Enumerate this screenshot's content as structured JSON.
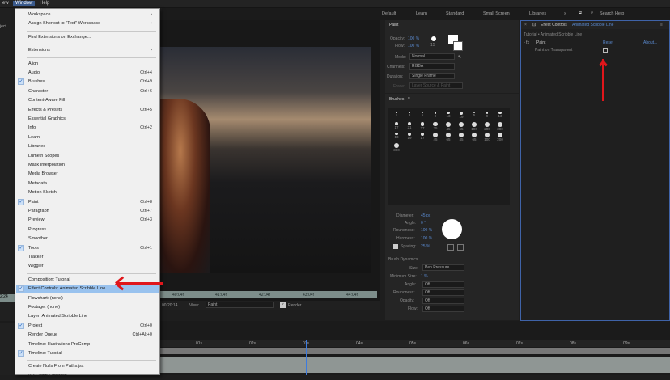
{
  "menubar": {
    "items": [
      "ew",
      "Window",
      "Help"
    ]
  },
  "workspaces": [
    "Default",
    "Learn",
    "Standard",
    "Small Screen",
    "Libraries"
  ],
  "search_placeholder": "Search Help",
  "menu": {
    "items": [
      {
        "label": "Workspace",
        "shortcut": "",
        "checked": false,
        "submenu": true
      },
      {
        "label": "Assign Shortcut to \"Text\" Workspace",
        "shortcut": "",
        "checked": false,
        "submenu": true
      },
      {
        "sep": true
      },
      {
        "label": "Find Extensions on Exchange...",
        "shortcut": "",
        "checked": false
      },
      {
        "sep": true
      },
      {
        "label": "Extensions",
        "shortcut": "",
        "checked": false,
        "submenu": true
      },
      {
        "sep": true
      },
      {
        "label": "Align",
        "shortcut": "",
        "checked": false
      },
      {
        "label": "Audio",
        "shortcut": "Ctrl+4",
        "checked": false
      },
      {
        "label": "Brushes",
        "shortcut": "Ctrl+9",
        "checked": true
      },
      {
        "label": "Character",
        "shortcut": "Ctrl+6",
        "checked": false
      },
      {
        "label": "Content-Aware Fill",
        "shortcut": "",
        "checked": false
      },
      {
        "label": "Effects & Presets",
        "shortcut": "Ctrl+5",
        "checked": false
      },
      {
        "label": "Essential Graphics",
        "shortcut": "",
        "checked": false
      },
      {
        "label": "Info",
        "shortcut": "Ctrl+2",
        "checked": false
      },
      {
        "label": "Learn",
        "shortcut": "",
        "checked": false
      },
      {
        "label": "Libraries",
        "shortcut": "",
        "checked": false
      },
      {
        "label": "Lumetri Scopes",
        "shortcut": "",
        "checked": false
      },
      {
        "label": "Mask Interpolation",
        "shortcut": "",
        "checked": false
      },
      {
        "label": "Media Browser",
        "shortcut": "",
        "checked": false
      },
      {
        "label": "Metadata",
        "shortcut": "",
        "checked": false
      },
      {
        "label": "Motion Sketch",
        "shortcut": "",
        "checked": false
      },
      {
        "label": "Paint",
        "shortcut": "Ctrl+8",
        "checked": true
      },
      {
        "label": "Paragraph",
        "shortcut": "Ctrl+7",
        "checked": false
      },
      {
        "label": "Preview",
        "shortcut": "Ctrl+3",
        "checked": false
      },
      {
        "label": "Progress",
        "shortcut": "",
        "checked": false
      },
      {
        "label": "Smoother",
        "shortcut": "",
        "checked": false
      },
      {
        "label": "Tools",
        "shortcut": "Ctrl+1",
        "checked": true
      },
      {
        "label": "Tracker",
        "shortcut": "",
        "checked": false
      },
      {
        "label": "Wiggler",
        "shortcut": "",
        "checked": false
      },
      {
        "sep": true
      },
      {
        "label": "Composition: Tutorial",
        "shortcut": "",
        "checked": false
      },
      {
        "label": "Effect Controls: Animated Scribble Line",
        "shortcut": "",
        "checked": true,
        "highlight": true
      },
      {
        "label": "Flowchart: (none)",
        "shortcut": "",
        "checked": false
      },
      {
        "label": "Footage: (none)",
        "shortcut": "",
        "checked": false
      },
      {
        "label": "Layer: Animated Scribble Line",
        "shortcut": "",
        "checked": false
      },
      {
        "label": "Project",
        "shortcut": "Ctrl+0",
        "checked": true
      },
      {
        "label": "Render Queue",
        "shortcut": "Ctrl+Alt+0",
        "checked": false
      },
      {
        "label": "Timeline: Illustrations PreComp",
        "shortcut": "",
        "checked": false
      },
      {
        "label": "Timeline: Tutorial",
        "shortcut": "",
        "checked": true
      },
      {
        "sep": true
      },
      {
        "label": "Create Nulls From Paths.jsx",
        "shortcut": "",
        "checked": false
      },
      {
        "label": "VR Comp Editor.jsx",
        "shortcut": "",
        "checked": false
      }
    ]
  },
  "comp": {
    "ruler": [
      "40:04f",
      "41:04f",
      "42:04f",
      "43:04f",
      "44:04f"
    ],
    "footer_time": "00:20:14",
    "view_label": "View:",
    "view_value": "Paint",
    "render_label": "Render"
  },
  "paint": {
    "tab": "Paint",
    "opacity_label": "Opacity:",
    "opacity_value": "100 %",
    "flow_label": "Flow:",
    "flow_value": "100 %",
    "size_value": "15",
    "mode_label": "Mode:",
    "mode_value": "Normal",
    "channels_label": "Channels:",
    "channels_value": "RGBA",
    "duration_label": "Duration:",
    "duration_value": "Single Frame",
    "erase_label": "Erase:",
    "erase_value": "Layer Source & Paint"
  },
  "brushes": {
    "tab": "Brushes",
    "sizes": [
      "1",
      "3",
      "5",
      "9",
      "13",
      "19",
      "5",
      "9",
      "13",
      "17",
      "21",
      "27",
      "35",
      "45",
      "65",
      "100",
      "200",
      "300",
      "13",
      "19",
      "17",
      "45",
      "65",
      "45",
      "65",
      "100",
      "200",
      "300"
    ],
    "diameter_label": "Diameter:",
    "diameter_value": "45 px",
    "angle_label": "Angle:",
    "angle_value": "0 °",
    "roundness_label": "Roundness:",
    "roundness_value": "100 %",
    "hardness_label": "Hardness:",
    "hardness_value": "100 %",
    "spacing_label": "Spacing:",
    "spacing_value": "25 %",
    "dynamics_label": "Brush Dynamics",
    "size_label": "Size:",
    "size_value": "Pen Pressure",
    "minsize_label": "Minimum Size:",
    "minsize_value": "1 %",
    "angle_dyn_label": "Angle:",
    "angle_dyn_value": "Off",
    "roundness_dyn_label": "Roundness:",
    "roundness_dyn_value": "Off",
    "opacity_dyn_label": "Opacity:",
    "opacity_dyn_value": "Off",
    "flow_dyn_label": "Flow:",
    "flow_dyn_value": "Off"
  },
  "effect_controls": {
    "tab": "Effect Controls",
    "tab_layer": "Animated Scribble Line",
    "breadcrumb": "Tutorial • Animated Scribble Line",
    "effect_name": "Paint",
    "reset": "Reset",
    "about": "About...",
    "property": "Paint on Transparent"
  },
  "timeline": {
    "ticks": [
      "01s",
      "02s",
      "03s",
      "04s",
      "05s",
      "06s",
      "07s",
      "08s",
      "09s"
    ]
  },
  "left_labels": [
    "ject",
    "2:24"
  ],
  "colors": {
    "accent": "#3c7be0",
    "annotation": "#e0161b",
    "menu_highlight": "#99c2ee"
  }
}
